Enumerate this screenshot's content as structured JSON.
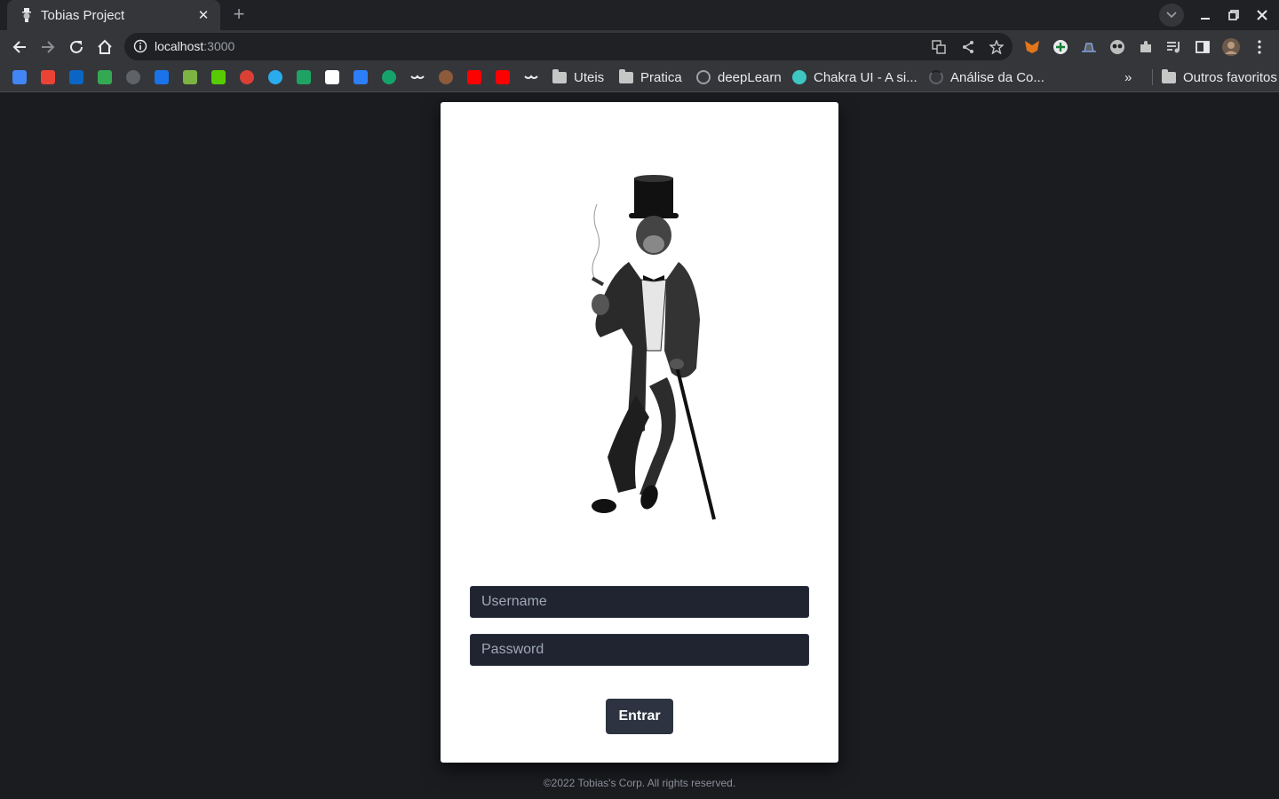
{
  "browser": {
    "tab_title": "Tobias Project",
    "url_host": "localhost",
    "url_port": ":3000",
    "bookmarks": {
      "folders": [
        "Uteis",
        "Pratica"
      ],
      "links": [
        "deepLearn",
        "Chakra UI - A si...",
        "Análise da Co..."
      ],
      "overflow_label": "»",
      "other_label": "Outros favoritos"
    }
  },
  "login": {
    "username_placeholder": "Username",
    "password_placeholder": "Password",
    "submit_label": "Entrar"
  },
  "footer": {
    "text": "©2022 Tobias's Corp. All rights reserved."
  },
  "colors": {
    "page_bg": "#1b1c20",
    "card_bg": "#ffffff",
    "input_bg": "#1f2430",
    "button_bg": "#2d3340",
    "chrome_bg": "#35363a"
  }
}
